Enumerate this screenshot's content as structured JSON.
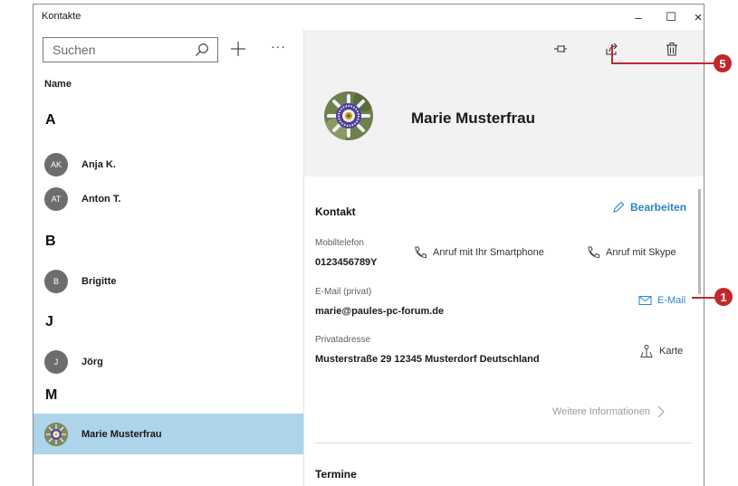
{
  "window": {
    "title": "Kontakte",
    "controls": {
      "minimize": "–",
      "maximize": "☐",
      "close": "×"
    }
  },
  "sidebar": {
    "search_placeholder": "Suchen",
    "add_label": "+",
    "more_label": "···",
    "header": "Name",
    "groups": [
      {
        "letter": "A",
        "contacts": [
          {
            "initials": "AK",
            "name": "Anja K."
          },
          {
            "initials": "AT",
            "name": "Anton T."
          }
        ]
      },
      {
        "letter": "B",
        "contacts": [
          {
            "initials": "B",
            "name": "Brigitte"
          }
        ]
      },
      {
        "letter": "J",
        "contacts": [
          {
            "initials": "J",
            "name": "Jörg"
          }
        ]
      },
      {
        "letter": "M",
        "contacts": [
          {
            "initials": "",
            "name": "Marie Musterfrau",
            "selected": true
          }
        ]
      }
    ]
  },
  "detail": {
    "toolbar": {
      "pin": "pin-icon",
      "share": "share-icon",
      "delete": "trash-icon"
    },
    "name": "Marie Musterfrau",
    "contact_section": "Kontakt",
    "edit_label": "Bearbeiten",
    "phone": {
      "label": "Mobiltelefon",
      "value": "0123456789Y",
      "action_smartphone": "Anruf mit Ihr Smartphone",
      "action_skype": "Anruf mit Skype"
    },
    "email": {
      "label": "E-Mail (privat)",
      "value": "marie@paules-pc-forum.de",
      "action": "E-Mail"
    },
    "address": {
      "label": "Privatadresse",
      "value": "Musterstraße 29 12345 Musterdorf Deutschland",
      "action": "Karte"
    },
    "more_info": "Weitere Informationen",
    "appointments_section": "Termine"
  },
  "callouts": {
    "share": "5",
    "email": "1"
  },
  "colors": {
    "accent": "#2b86c5",
    "selected_row": "#add4ea",
    "callout": "#c1272d",
    "hero_bg": "#f2f2f2"
  }
}
